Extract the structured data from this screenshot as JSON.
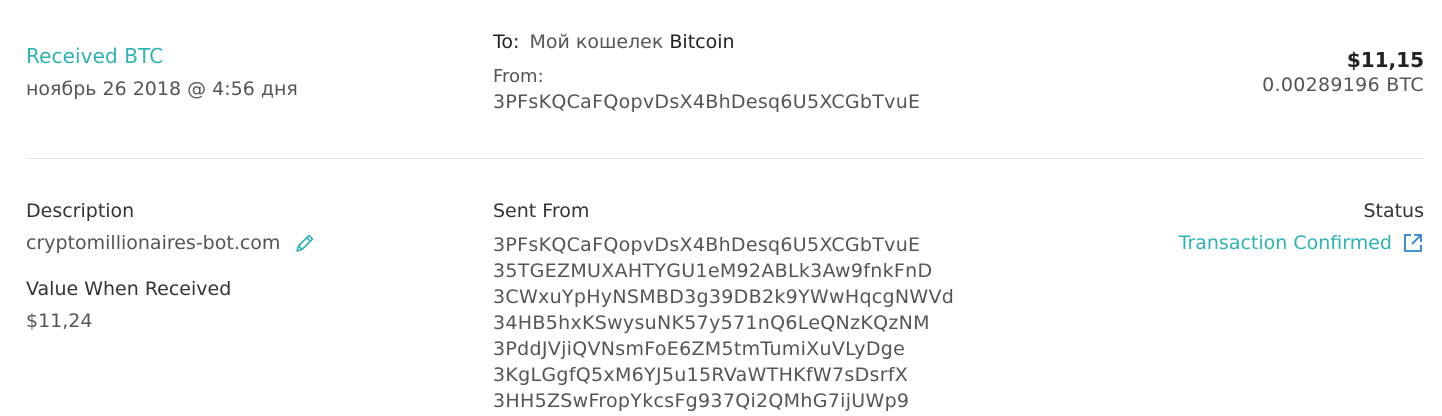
{
  "transaction": {
    "type_label": "Received BTC",
    "date": "ноябрь 26 2018 @ 4:56 дня",
    "to_label": "To:",
    "to_wallet": "Мой кошелек",
    "to_coin": "Bitcoin",
    "from_label": "From:",
    "from_address": "3PFsKQCaFQopvDsX4BhDesq6U5XCGbTvuE",
    "amount_usd": "$11,15",
    "amount_btc": "0.00289196 BTC"
  },
  "details": {
    "description_label": "Description",
    "description_value": "cryptomillionaires-bot.com",
    "value_label": "Value When Received",
    "value_amount": "$11,24",
    "sent_from_label": "Sent From",
    "sent_from_addresses": [
      "3PFsKQCaFQopvDsX4BhDesq6U5XCGbTvuE",
      "35TGEZMUXAHTYGU1eM92ABLk3Aw9fnkFnD",
      "3CWxuYpHyNSMBD3g39DB2k9YWwHqcgNWVd",
      "34HB5hxKSwysuNK57y571nQ6LeQNzKQzNM",
      "3PddJVjiQVNsmFoE6ZM5tmTumiXuVLyDge",
      "3KgLGgfQ5xM6YJ5u15RVaWTHKfW7sDsrfX",
      "3HH5ZSwFropYkcsFg937Qi2QMhG7ijUWp9"
    ],
    "status_label": "Status",
    "status_value": "Transaction Confirmed"
  },
  "icons": {
    "edit": "pencil-icon",
    "external": "external-link-icon"
  },
  "colors": {
    "accent": "#2eb3b3",
    "text": "#4b4b4b",
    "divider": "#e4e4e4"
  }
}
